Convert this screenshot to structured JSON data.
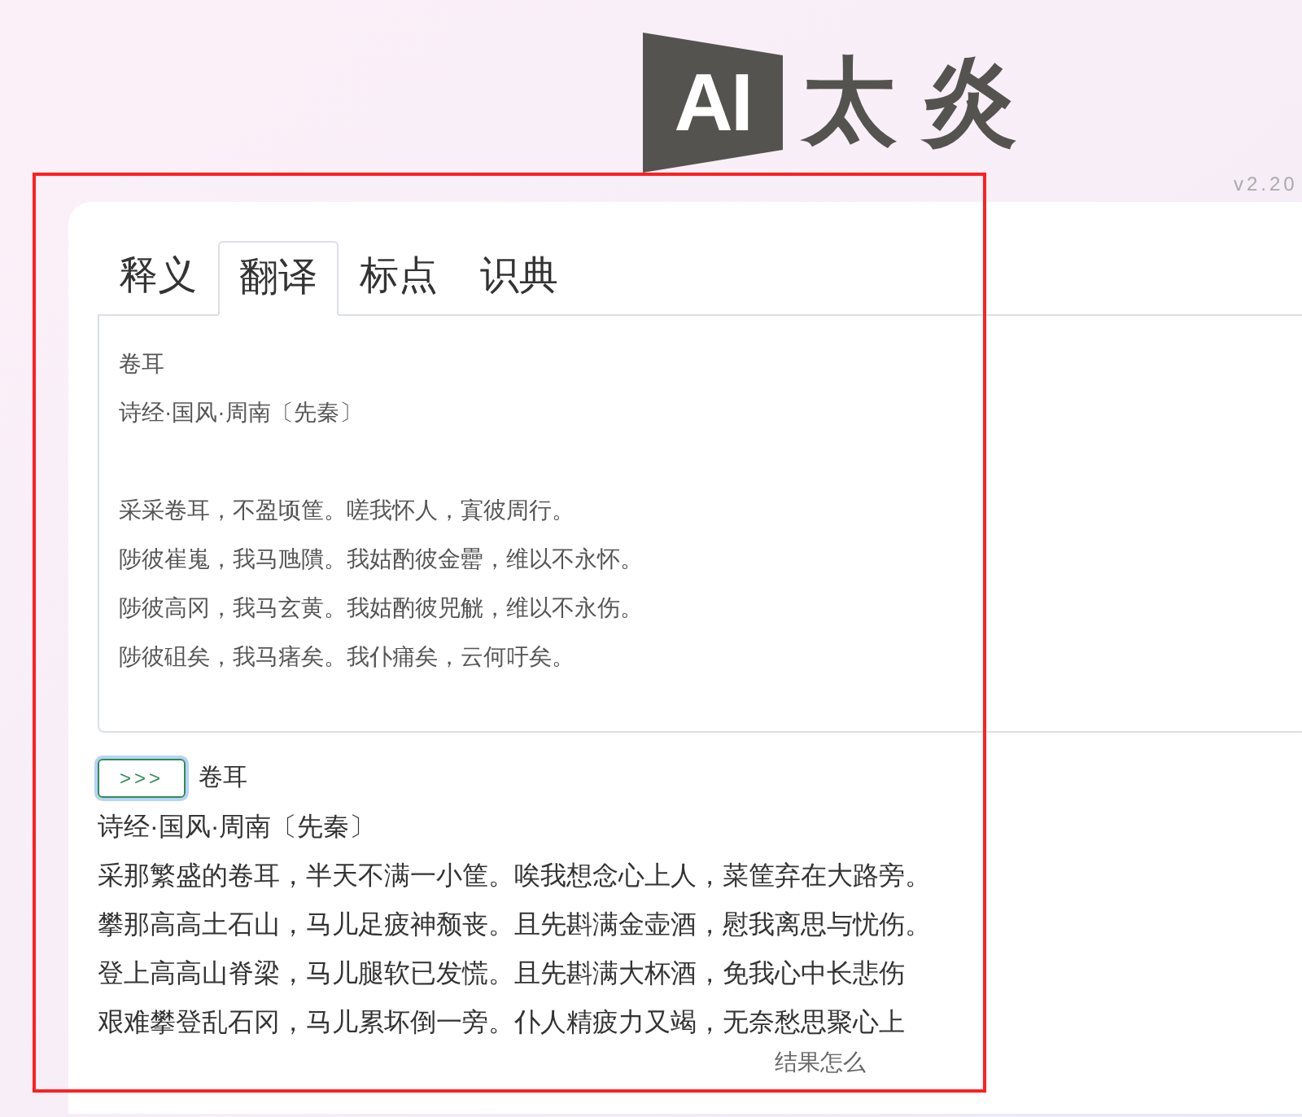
{
  "logo": {
    "mark": "AI",
    "name": "太 炎"
  },
  "version": "v2.20",
  "tabs": [
    {
      "label": "释义",
      "selected": false
    },
    {
      "label": "翻译",
      "selected": true
    },
    {
      "label": "标点",
      "selected": false
    },
    {
      "label": "识典",
      "selected": false
    }
  ],
  "input": {
    "title": "卷耳",
    "source": "诗经·国风·周南〔先秦〕",
    "lines": [
      "采采卷耳，不盈顷筐。嗟我怀人，寘彼周行。",
      "陟彼崔嵬，我马虺隤。我姑酌彼金罍，维以不永怀。",
      "陟彼高冈，我马玄黄。我姑酌彼兕觥，维以不永伤。",
      "陟彼砠矣，我马瘏矣。我仆痡矣，云何吁矣。"
    ]
  },
  "result": {
    "button": ">>>",
    "title": "卷耳",
    "lines": [
      "诗经·国风·周南〔先秦〕",
      "采那繁盛的卷耳，半天不满一小筐。唉我想念心上人，菜筐弃在大路旁。",
      "攀那高高土石山，马儿足疲神颓丧。且先斟满金壶酒，慰我离思与忧伤。",
      "登上高高山脊梁，马儿腿软已发慌。且先斟满大杯酒，免我心中长悲伤",
      "艰难攀登乱石冈，马儿累坏倒一旁。仆人精疲力又竭，无奈愁思聚心上"
    ]
  },
  "footer": "结果怎么"
}
